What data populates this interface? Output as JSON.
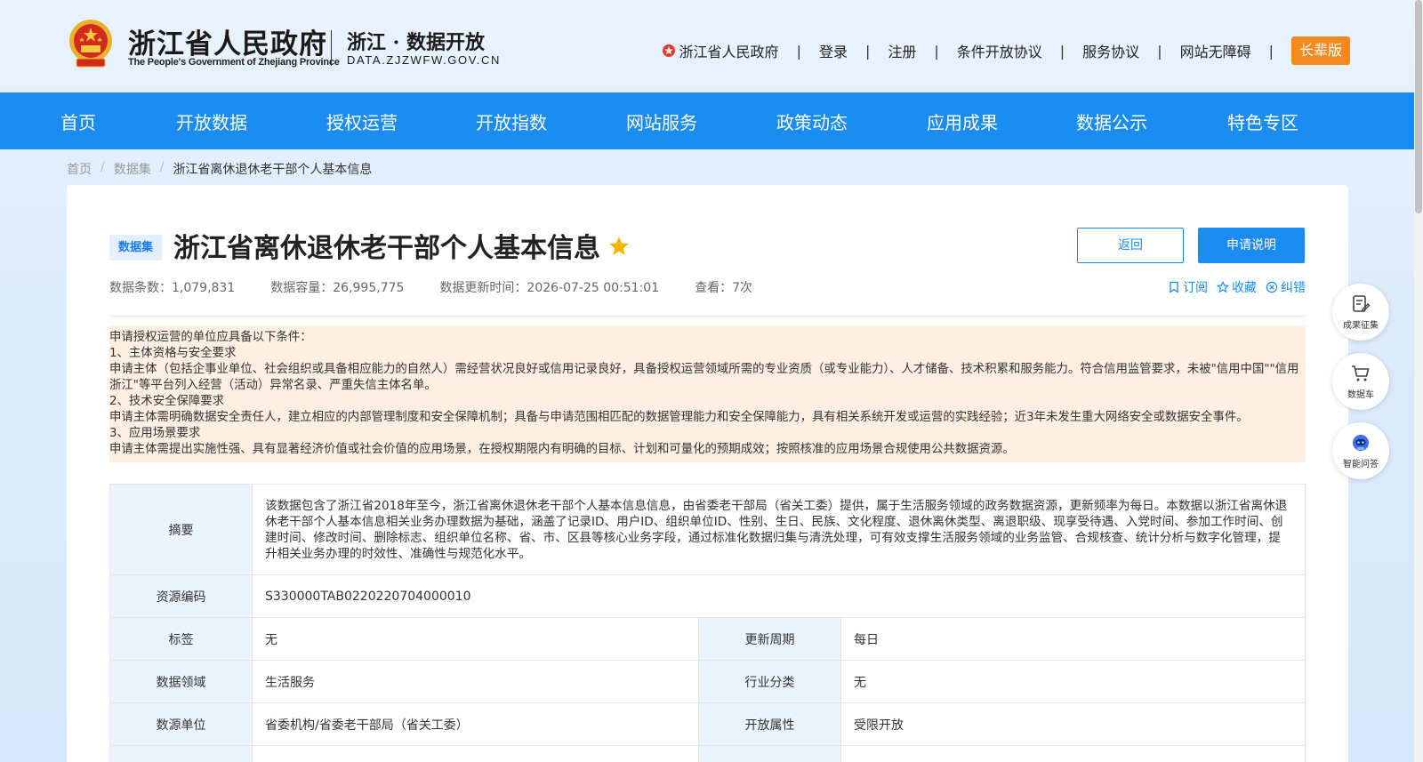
{
  "header": {
    "gov_title": "浙江省人民政府",
    "gov_subtitle": "The People's Government of Zhejiang Province",
    "open_title": "浙江 · 数据开放",
    "open_subtitle": "DATA.ZJZWFW.GOV.CN",
    "links": [
      "浙江省人民政府",
      "登录",
      "注册",
      "条件开放协议",
      "服务协议",
      "网站无障碍"
    ],
    "separator": "|",
    "elder_button": "长辈版"
  },
  "nav": [
    "首页",
    "开放数据",
    "授权运营",
    "开放指数",
    "网站服务",
    "政策动态",
    "应用成果",
    "数据公示",
    "特色专区"
  ],
  "breadcrumb": {
    "items": [
      "首页",
      "数据集",
      "浙江省离休退休老干部个人基本信息"
    ],
    "separator": "/"
  },
  "dataset": {
    "badge": "数据集",
    "title": "浙江省离休退休老干部个人基本信息",
    "back_button": "返回",
    "apply_button": "申请说明",
    "stats": [
      "数据条数：1,079,831",
      "数据容量：26,995,775",
      "数据更新时间：2026-07-25 00:51:01",
      "查看：7次"
    ],
    "actions": [
      "订阅",
      "收藏",
      "纠错"
    ]
  },
  "notice": [
    "申请授权运营的单位应具备以下条件：",
    "1、主体资格与安全要求",
    "申请主体（包括企事业单位、社会组织或具备相应能力的自然人）需经营状况良好或信用记录良好，具备授权运营领域所需的专业资质（或专业能力）、人才储备、技术积累和服务能力。符合信用监管要求，未被\"信用中国\"\"信用浙江\"等平台列入经营（活动）异常名录、严重失信主体名单。",
    "2、技术安全保障要求",
    "申请主体需明确数据安全责任人，建立相应的内部管理制度和安全保障机制；具备与申请范围相匹配的数据管理能力和安全保障能力，具有相关系统开发或运营的实践经验；近3年未发生重大网络安全或数据安全事件。",
    "3、应用场景要求",
    "申请主体需提出实施性强、具有显著经济价值或社会价值的应用场景，在授权期限内有明确的目标、计划和可量化的预期成效；按照核准的应用场景合规使用公共数据资源。"
  ],
  "table": {
    "abstract_key": "摘要",
    "abstract_value": "该数据包含了浙江省2018年至今，浙江省离休退休老干部个人基本信息信息，由省委老干部局（省关工委）提供，属于生活服务领域的政务数据资源，更新频率为每日。本数据以浙江省离休退休老干部个人基本信息相关业务办理数据为基础，涵盖了记录ID、用户ID、组织单位ID、性别、生日、民族、文化程度、退休离休类型、离退职级、现享受待遇、入党时间、参加工作时间、创建时间、修改时间、删除标志、组织单位名称、省、市、区县等核心业务字段，通过标准化数据归集与清洗处理，可有效支撑生活服务领域的业务监管、合规核查、统计分析与数字化管理，提升相关业务办理的时效性、准确性与规范化水平。",
    "code_key": "资源编码",
    "code_value": "S330000TAB0220220704000010",
    "rows": [
      {
        "k1": "标签",
        "v1": "无",
        "k2": "更新周期",
        "v2": "每日"
      },
      {
        "k1": "数据领域",
        "v1": "生活服务",
        "k2": "行业分类",
        "v2": "无"
      },
      {
        "k1": "数源单位",
        "v1": "省委机构/省委老干部局（省关工委）",
        "k2": "开放属性",
        "v2": "受限开放"
      }
    ]
  },
  "floats": [
    "成果征集",
    "数据车",
    "智能问答"
  ],
  "colors": {
    "primary": "#1b8cf2",
    "elder": "#f28a1d",
    "notice_bg": "#fdf0e3",
    "key_bg": "#ebf3fc",
    "star": "#f5b700"
  }
}
